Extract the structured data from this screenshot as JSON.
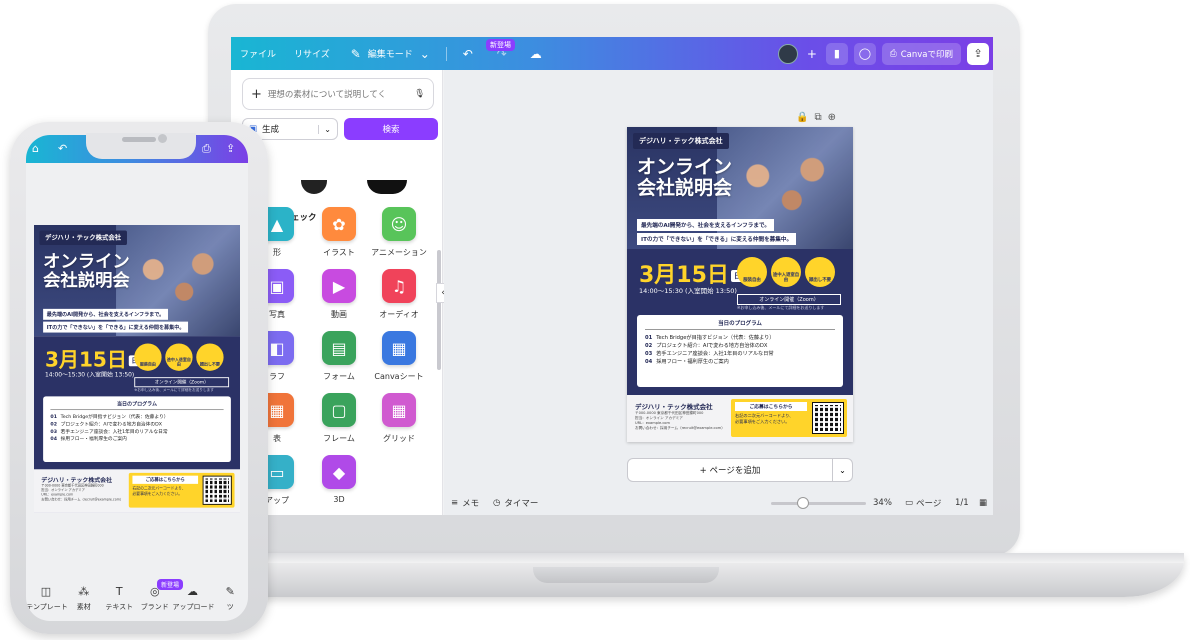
{
  "editor": {
    "menu": {
      "file": "ファイル",
      "resize": "リサイズ",
      "edit_mode": "編集モード",
      "new_badge": "新登場",
      "print": "Canvaで印刷"
    },
    "panel": {
      "search_placeholder": "理想の素材について説明してく",
      "generate": "生成",
      "search_button": "検索",
      "heading": "リーをチェック",
      "tiles": [
        {
          "label": "形",
          "icon": "shape-icon",
          "color": "#2bb3c8",
          "glyph": "▲"
        },
        {
          "label": "イラスト",
          "icon": "flower-icon",
          "color": "#ff8a3d",
          "glyph": "✿"
        },
        {
          "label": "アニメーション",
          "icon": "smiley-icon",
          "color": "#58c45a",
          "glyph": "☺"
        },
        {
          "label": "写真",
          "icon": "photo-icon",
          "color": "#8b5cf6",
          "glyph": "▣"
        },
        {
          "label": "動画",
          "icon": "video-icon",
          "color": "#c84be0",
          "glyph": "▶"
        },
        {
          "label": "オーディオ",
          "icon": "music-icon",
          "color": "#f0435a",
          "glyph": "♫"
        },
        {
          "label": "ラフ",
          "icon": "chart-icon",
          "color": "#7c6cf0",
          "glyph": "◧"
        },
        {
          "label": "フォーム",
          "icon": "form-icon",
          "color": "#3aa35c",
          "glyph": "▤"
        },
        {
          "label": "Canvaシート",
          "icon": "sheet-icon",
          "color": "#3a78e0",
          "glyph": "▦"
        },
        {
          "label": "表",
          "icon": "table-icon",
          "color": "#f0743a",
          "glyph": "▦"
        },
        {
          "label": "フレーム",
          "icon": "frame-icon",
          "color": "#3aa35c",
          "glyph": "▢"
        },
        {
          "label": "グリッド",
          "icon": "grid-icon",
          "color": "#d05ad0",
          "glyph": "▦"
        },
        {
          "label": "アップ",
          "icon": "mockup-icon",
          "color": "#35b0c8",
          "glyph": "▭"
        },
        {
          "label": "3D",
          "icon": "cube-icon",
          "color": "#b04ae8",
          "glyph": "◆"
        }
      ]
    },
    "canvas": {
      "add_page": "+ ページを追加"
    },
    "bottom": {
      "memo": "メモ",
      "timer": "タイマー",
      "zoom": "34%",
      "page_label": "ページ",
      "page_count": "1/1"
    }
  },
  "flyer": {
    "company": "デジハリ・テック株式会社",
    "title_line1": "オンライン",
    "title_line2": "会社説明会",
    "tag1": "最先端のAI開発から、社会を支えるインフラまで。",
    "tag2": "ITの力で「できない」を「できる」に変える仲間を募集中。",
    "date": "3月15日",
    "day": "日",
    "time": "14:00〜15:30 (入室開始 13:50)",
    "circles": [
      "服装自由",
      "途中入退室自由",
      "顔出し不要"
    ],
    "online": "オンライン開催（Zoom）",
    "note": "※お申し込み後、メールにて詳細をお送りします",
    "program_title": "当日のプログラム",
    "program": [
      {
        "no": "01",
        "text": "Tech Bridgeが目指すビジョン（代表：佐藤より）"
      },
      {
        "no": "02",
        "text": "プロジェクト紹介：AIで変わる地方自治体のDX"
      },
      {
        "no": "03",
        "text": "若手エンジニア座談会：入社1年目のリアルな日常"
      },
      {
        "no": "04",
        "text": "採用フロー・福利厚生のご案内"
      }
    ],
    "footer_company": "デジハリ・テック株式会社",
    "footer_info": [
      "〒000-0000 東京都千代田区神田錦町000",
      "担当：オンライン アカデミア",
      "URL：example.com",
      "お問い合わせ：採用チーム（recruit@example.com）"
    ],
    "apply_title": "ご応募はこちらから",
    "apply_text": [
      "右記の二次元バーコードより、",
      "必要事項をご入力ください。"
    ]
  },
  "phone": {
    "nav": [
      {
        "label": "テンプレート",
        "icon": "template-icon",
        "glyph": "◫"
      },
      {
        "label": "素材",
        "icon": "elements-icon",
        "glyph": "⁂"
      },
      {
        "label": "テキスト",
        "icon": "text-icon",
        "glyph": "T"
      },
      {
        "label": "ブランド",
        "icon": "brand-icon",
        "glyph": "◎"
      },
      {
        "label": "アップロード",
        "icon": "upload-icon",
        "glyph": "☁"
      },
      {
        "label": "ツ",
        "icon": "tools-icon",
        "glyph": "✎"
      }
    ],
    "new_badge": "新登場"
  }
}
